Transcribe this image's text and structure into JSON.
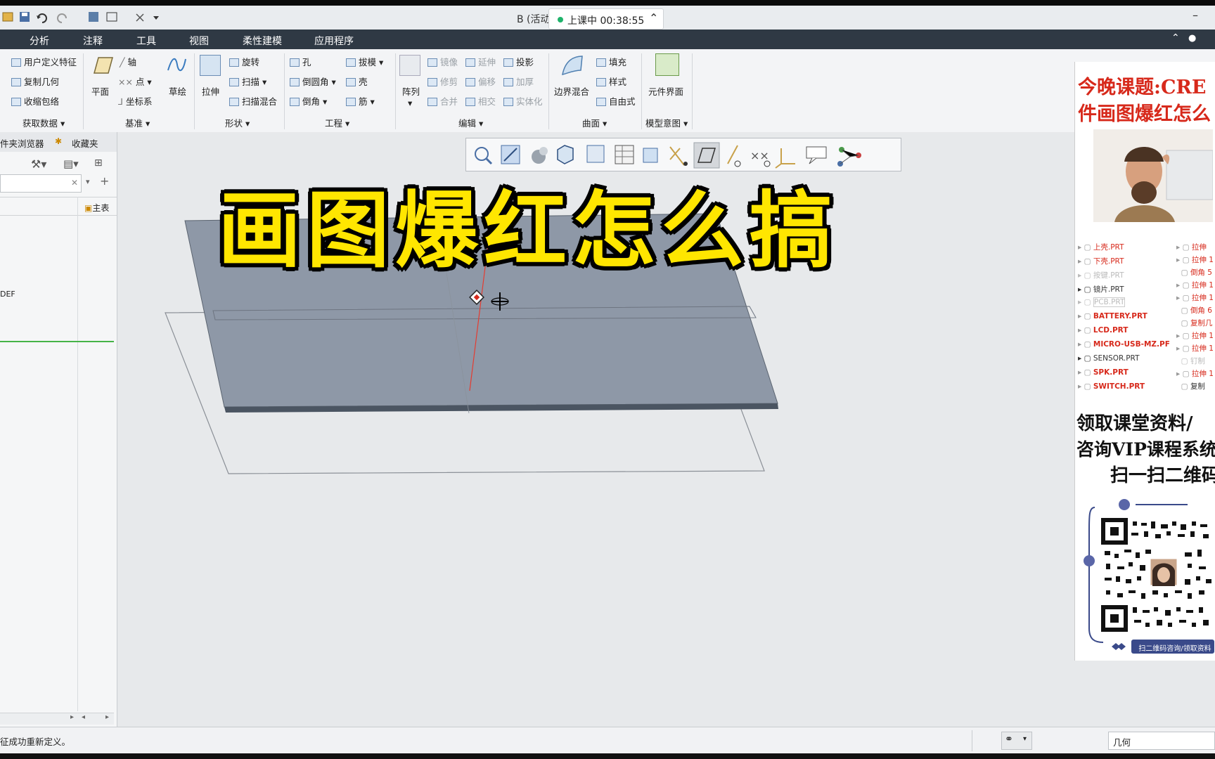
{
  "window": {
    "title": "B (活动",
    "recording_label": "上课中 00:38:55"
  },
  "menu": [
    "分析",
    "注释",
    "工具",
    "视图",
    "柔性建模",
    "应用程序"
  ],
  "ribbon": {
    "get_data": {
      "items": [
        "用户定义特征",
        "复制几何",
        "收缩包络"
      ],
      "group": "获取数据"
    },
    "datum": {
      "plane": "平面",
      "axis": "轴",
      "point": "点",
      "csys": "坐标系",
      "sketch": "草绘",
      "group": "基准"
    },
    "shapes": {
      "extrude": "拉伸",
      "revolve": "旋转",
      "sweep": "扫描",
      "swept_blend": "扫描混合",
      "group": "形状"
    },
    "engineering": {
      "hole": "孔",
      "round": "倒圆角",
      "chamfer": "倒角",
      "draft": "拔模",
      "shell": "壳",
      "rib": "筋",
      "group": "工程"
    },
    "editing": {
      "pattern": "阵列",
      "mirror": "镜像",
      "trim": "修剪",
      "merge": "合并",
      "extend": "延伸",
      "offset": "偏移",
      "intersect": "相交",
      "project": "投影",
      "thicken": "加厚",
      "solidify": "实体化",
      "group": "编辑"
    },
    "surfaces": {
      "boundary_blend": "边界混合",
      "fill": "填充",
      "style": "样式",
      "freestyle": "自由式",
      "group": "曲面"
    },
    "model_intent": {
      "component_interface": "元件界面",
      "group": "模型意图"
    }
  },
  "left_panel": {
    "tab_folder": "件夹浏览器",
    "tab_favorites": "收藏夹",
    "tree_header": "主表",
    "tree_item": "DEF"
  },
  "overlay_title": "画图爆红怎么搞",
  "promo": {
    "headline_1": "今晚课题:CRE",
    "headline_2": "件画图爆红怎么",
    "tree_left": [
      "上壳.PRT",
      "下壳.PRT",
      "按键.PRT",
      "镜片.PRT",
      "PCB.PRT",
      "BATTERY.PRT",
      "LCD.PRT",
      "MICRO-USB-MZ.PF",
      "SENSOR.PRT",
      "SPK.PRT",
      "SWITCH.PRT"
    ],
    "tree_right": [
      "拉伸",
      "拉伸 1",
      "倒角 5",
      "拉伸 1",
      "拉伸 1",
      "倒角 6",
      "复制几",
      "拉伸 1",
      "拉伸 1",
      "钉制",
      "拉伸 1",
      "复制"
    ],
    "cta_1": "领取课堂资料/",
    "cta_2": "咨询VIP课程系统",
    "cta_3": "扫一扫二维码",
    "qr_caption": "扫二维码咨询/领取资料"
  },
  "status": {
    "message": "征成功重新定义。",
    "filter": "几何"
  },
  "colors": {
    "menubar": "#2f3944",
    "model_face": "#8e98a7",
    "overlay_text": "#ffe600",
    "promo_red": "#d7291b"
  }
}
